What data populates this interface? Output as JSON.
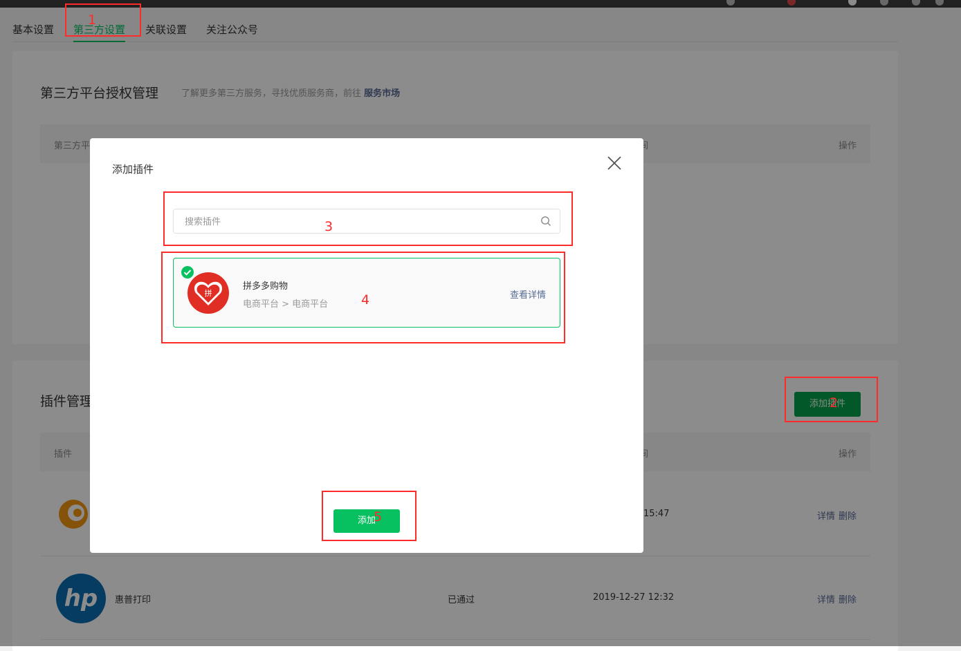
{
  "tabs": [
    {
      "label": "基本设置"
    },
    {
      "label": "第三方设置"
    },
    {
      "label": "关联设置"
    },
    {
      "label": "关注公众号"
    }
  ],
  "auth_section": {
    "title": "第三方平台授权管理",
    "desc": "了解更多第三方服务，寻找优质服务商，前往",
    "desc_link": "服务市场",
    "col_first": "第三方平",
    "col_mid": "间",
    "col_ops": "操作"
  },
  "plugin_section": {
    "title": "插件管理",
    "add_button": "添加插件",
    "col_plugin": "插件",
    "col_mid": "间",
    "col_ops": "操作",
    "rows": [
      {
        "name": "",
        "status": "",
        "time": "15:47",
        "detail": "详情",
        "delete": "删除",
        "logo": "orange-swirl-logo"
      },
      {
        "name": "惠普打印",
        "status": "已通过",
        "time": "2019-12-27 12:32",
        "detail": "详情",
        "delete": "删除",
        "logo": "hp-logo"
      }
    ]
  },
  "modal": {
    "title": "添加插件",
    "search_placeholder": "搜索插件",
    "plugin": {
      "name": "拼多多购物",
      "category": "电商平台 > 电商平台",
      "detail_link": "查看详情",
      "logo_text": "拼"
    },
    "add_button": "添加"
  },
  "annotations": [
    "1",
    "2",
    "3",
    "4",
    "5"
  ],
  "colors": {
    "accent": "#07c160",
    "link": "#576b95",
    "annotation": "#ff2a2a",
    "pdd_red": "#e02e24"
  }
}
